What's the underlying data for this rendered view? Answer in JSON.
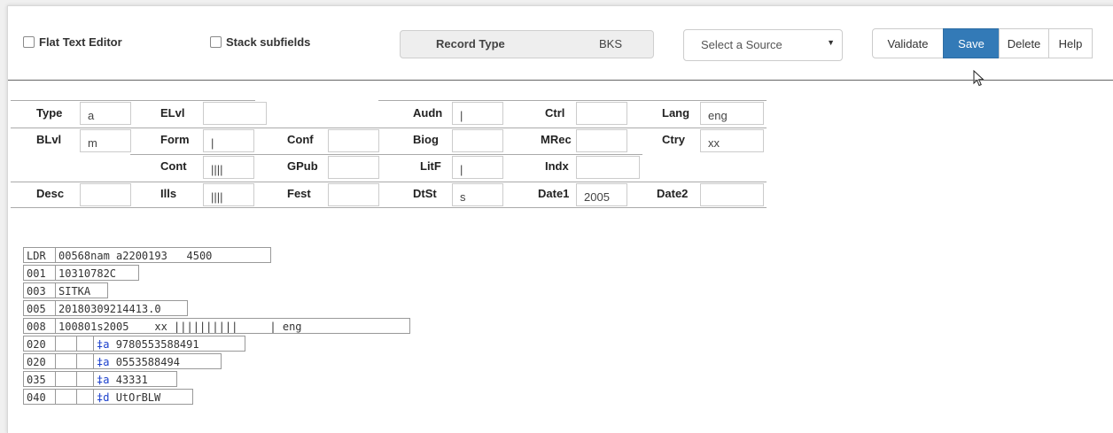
{
  "toolbar": {
    "flat_text_editor": "Flat Text Editor",
    "stack_subfields": "Stack subfields",
    "record_type_label": "Record Type",
    "record_type_value": "BKS",
    "source_placeholder": "Select a Source",
    "validate": "Validate",
    "save": "Save",
    "delete": "Delete",
    "help": "Help"
  },
  "fixed": {
    "type": {
      "label": "Type",
      "value": "a"
    },
    "elvl": {
      "label": "ELvl",
      "value": ""
    },
    "audn": {
      "label": "Audn",
      "value": "|"
    },
    "ctrl": {
      "label": "Ctrl",
      "value": ""
    },
    "lang": {
      "label": "Lang",
      "value": "eng"
    },
    "blvl": {
      "label": "BLvl",
      "value": "m"
    },
    "form": {
      "label": "Form",
      "value": "|"
    },
    "conf": {
      "label": "Conf",
      "value": ""
    },
    "biog": {
      "label": "Biog",
      "value": ""
    },
    "mrec": {
      "label": "MRec",
      "value": ""
    },
    "ctry": {
      "label": "Ctry",
      "value": "xx"
    },
    "cont": {
      "label": "Cont",
      "value": "||||"
    },
    "gpub": {
      "label": "GPub",
      "value": ""
    },
    "litf": {
      "label": "LitF",
      "value": "|"
    },
    "indx": {
      "label": "Indx",
      "value": ""
    },
    "desc": {
      "label": "Desc",
      "value": ""
    },
    "ills": {
      "label": "Ills",
      "value": "||||"
    },
    "fest": {
      "label": "Fest",
      "value": ""
    },
    "dtst": {
      "label": "DtSt",
      "value": "s"
    },
    "date1": {
      "label": "Date1",
      "value": "2005"
    },
    "date2": {
      "label": "Date2",
      "value": ""
    }
  },
  "marc": [
    {
      "tag": "LDR",
      "value": "00568nam a2200193   4500"
    },
    {
      "tag": "001",
      "value": "10310782C"
    },
    {
      "tag": "003",
      "value": "SITKA"
    },
    {
      "tag": "005",
      "value": "20180309214413.0"
    },
    {
      "tag": "008",
      "value": "100801s2005    xx ||||||||||     | eng  "
    },
    {
      "tag": "020",
      "ind1": "",
      "ind2": "",
      "code": "‡a",
      "value": "9780553588491"
    },
    {
      "tag": "020",
      "ind1": "",
      "ind2": "",
      "code": "‡a",
      "value": "0553588494"
    },
    {
      "tag": "035",
      "ind1": "",
      "ind2": "",
      "code": "‡a",
      "value": "43331"
    },
    {
      "tag": "040",
      "ind1": "",
      "ind2": "",
      "code": "‡d",
      "value": "UtOrBLW"
    }
  ]
}
